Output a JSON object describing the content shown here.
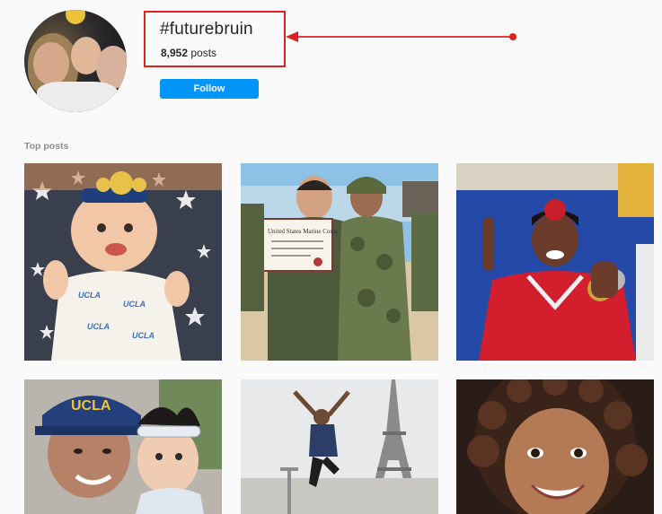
{
  "hashtag": {
    "title": "#futurebruin",
    "post_count": "8,952",
    "post_count_suffix": " posts",
    "follow_label": "Follow"
  },
  "annotation": {
    "color": "#e02020"
  },
  "section": {
    "top_posts_label": "Top posts"
  },
  "colors": {
    "follow_button": "#0095f6",
    "background": "#fafafa"
  },
  "posts": [
    {
      "desc": "baby-with-bow-on-star-pillow"
    },
    {
      "desc": "marine-graduates-holding-certificate"
    },
    {
      "desc": "gymnast-girl-with-medals"
    },
    {
      "desc": "mother-and-baby-selfie-ucla-cap"
    },
    {
      "desc": "girl-jumping-near-eiffel-tower"
    },
    {
      "desc": "smiling-girl-curly-hair"
    }
  ]
}
